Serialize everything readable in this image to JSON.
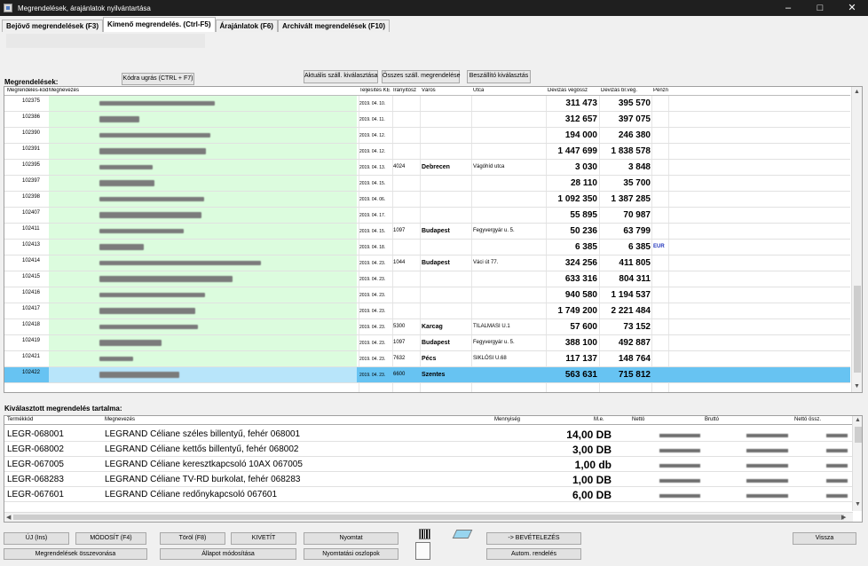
{
  "window": {
    "title": "Megrendelések, árajánlatok nyilvántartása",
    "minimize": "–",
    "maximize": "□",
    "close": "✕"
  },
  "tabs": [
    {
      "label": "Bejövő megrendelések (F3)"
    },
    {
      "label": "Kimenő megrendelés. (Ctrl-F5)"
    },
    {
      "label": "Árajánlatok (F6)"
    },
    {
      "label": "Archivált megrendelések (F10)"
    }
  ],
  "orders_section": {
    "label": "Megrendelések:"
  },
  "top_buttons": {
    "jump": "Kódra ugrás (CTRL + F7)",
    "current": "Aktuális száll. kiválasztása",
    "all": "Összes száll. megrendelése",
    "supplier": "Beszállító kiválasztás"
  },
  "orders_table": {
    "headers": [
      "Megrendelés-kód",
      "Megnevezés",
      "Teljesítés KE",
      "Irányítósz",
      "Város",
      "Utca",
      "Devizás végössz",
      "Devizás br.vég.",
      "Pénzn"
    ],
    "rows": [
      {
        "code": "102375",
        "date": "2019. 04. 10.",
        "zip": "",
        "city": "",
        "street": "",
        "net": "311 473",
        "gross": "395 570",
        "currency": ""
      },
      {
        "code": "102386",
        "date": "2019. 04. 11.",
        "zip": "",
        "city": "",
        "street": "",
        "net": "312 657",
        "gross": "397 075",
        "currency": ""
      },
      {
        "code": "102390",
        "date": "2019. 04. 12.",
        "zip": "",
        "city": "",
        "street": "",
        "net": "194 000",
        "gross": "246 380",
        "currency": ""
      },
      {
        "code": "102391",
        "date": "2019. 04. 12.",
        "zip": "",
        "city": "",
        "street": "",
        "net": "1 447 699",
        "gross": "1 838 578",
        "currency": ""
      },
      {
        "code": "102395",
        "date": "2019. 04. 13.",
        "zip": "4024",
        "city": "Debrecen",
        "street": "Vágóhíd utca",
        "net": "3 030",
        "gross": "3 848",
        "currency": ""
      },
      {
        "code": "102397",
        "date": "2019. 04. 15.",
        "zip": "",
        "city": "",
        "street": "",
        "net": "28 110",
        "gross": "35 700",
        "currency": ""
      },
      {
        "code": "102398",
        "date": "2019. 04. 06.",
        "zip": "",
        "city": "",
        "street": "",
        "net": "1 092 350",
        "gross": "1 387 285",
        "currency": ""
      },
      {
        "code": "102407",
        "date": "2019. 04. 17.",
        "zip": "",
        "city": "",
        "street": "",
        "net": "55 895",
        "gross": "70 987",
        "currency": ""
      },
      {
        "code": "102411",
        "date": "2019. 04. 15.",
        "zip": "1097",
        "city": "Budapest",
        "street": "Fegyvergyár u. 5.",
        "net": "50 236",
        "gross": "63 799",
        "currency": ""
      },
      {
        "code": "102413",
        "date": "2019. 04. 18.",
        "zip": "",
        "city": "",
        "street": "",
        "net": "6 385",
        "gross": "6 385",
        "currency": "EUR"
      },
      {
        "code": "102414",
        "date": "2019. 04. 23.",
        "zip": "1044",
        "city": "Budapest",
        "street": "Váci út 77.",
        "net": "324 256",
        "gross": "411 805",
        "currency": ""
      },
      {
        "code": "102415",
        "date": "2019. 04. 23.",
        "zip": "",
        "city": "",
        "street": "",
        "net": "633 316",
        "gross": "804 311",
        "currency": ""
      },
      {
        "code": "102416",
        "date": "2019. 04. 23.",
        "zip": "",
        "city": "",
        "street": "",
        "net": "940 580",
        "gross": "1 194 537",
        "currency": ""
      },
      {
        "code": "102417",
        "date": "2019. 04. 23.",
        "zip": "",
        "city": "",
        "street": "",
        "net": "1 749 200",
        "gross": "2 221 484",
        "currency": ""
      },
      {
        "code": "102418",
        "date": "2019. 04. 23.",
        "zip": "5300",
        "city": "Karcag",
        "street": "TILALMASI U.1",
        "net": "57 600",
        "gross": "73 152",
        "currency": ""
      },
      {
        "code": "102419",
        "date": "2019. 04. 23.",
        "zip": "1097",
        "city": "Budapest",
        "street": "Fegyvergyár u. 5.",
        "net": "388 100",
        "gross": "492 887",
        "currency": ""
      },
      {
        "code": "102421",
        "date": "2019. 04. 23.",
        "zip": "7632",
        "city": "Pécs",
        "street": "SIKLÓSI U.68",
        "net": "117 137",
        "gross": "148 764",
        "currency": ""
      },
      {
        "code": "102422",
        "date": "2019. 04. 23.",
        "zip": "6600",
        "city": "Szentes",
        "street": "",
        "net": "563 631",
        "gross": "715 812",
        "currency": ""
      }
    ]
  },
  "selected_section": {
    "label": "Kiválasztott megrendelés tartalma:"
  },
  "items_table": {
    "headers": [
      "Termékkód",
      "Megnevezés",
      "Mennyiség",
      "M.e.",
      "Nettó",
      "Bruttó",
      "Nettó össz."
    ],
    "rows": [
      {
        "sku": "LEGR-068001",
        "description": "LEGRAND Céliane széles billentyű, fehér 068001",
        "quantity": "14,00 DB"
      },
      {
        "sku": "LEGR-068002",
        "description": "LEGRAND Céliane kettős billentyű, fehér 068002",
        "quantity": "3,00 DB"
      },
      {
        "sku": "LEGR-067005",
        "description": "LEGRAND Céliane keresztkapcsoló 10AX 067005",
        "quantity": "1,00 db"
      },
      {
        "sku": "LEGR-068283",
        "description": "LEGRAND Céliane TV-RD burkolat, fehér 068283",
        "quantity": "1,00 DB"
      },
      {
        "sku": "LEGR-067601",
        "description": "LEGRAND Céliane redőnykapcsoló 067601",
        "quantity": "6,00 DB"
      }
    ]
  },
  "bottom_buttons": {
    "new": "ÚJ (Ins)",
    "modify": "MÓDOSÍT (F4)",
    "delete": "Töröl (F8)",
    "issue": "KIVETÍT",
    "print": "Nyomtat",
    "receive": "-> BEVÉTELEZÉS",
    "back": "Vissza",
    "merge": "Megrendelések összevonása",
    "status": "Állapot módosítása",
    "print_columns": "Nyomtatási oszlopok",
    "auto_order": "Autom. rendelés"
  },
  "icons": [
    "barcode-icon",
    "document-icon",
    "scanner-icon"
  ],
  "colors": {
    "titlebar": "#1f1f1f",
    "name_cell": "#dcfcde",
    "selected_row": "#67c3f2",
    "currency": "#2336bc"
  }
}
